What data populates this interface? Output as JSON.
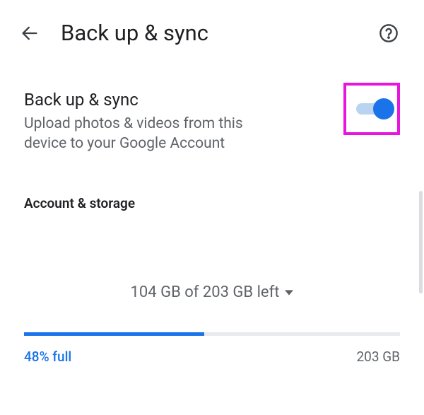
{
  "header": {
    "title": "Back up & sync"
  },
  "backup": {
    "title": "Back up & sync",
    "subtitle": "Upload photos & videos from this device to your Google Account",
    "enabled": true
  },
  "sections": {
    "account_storage_header": "Account & storage"
  },
  "storage": {
    "summary": "104 GB of 203 GB left",
    "percent_full_label": "48% full",
    "total_label": "203 GB",
    "percent_used": 48
  }
}
